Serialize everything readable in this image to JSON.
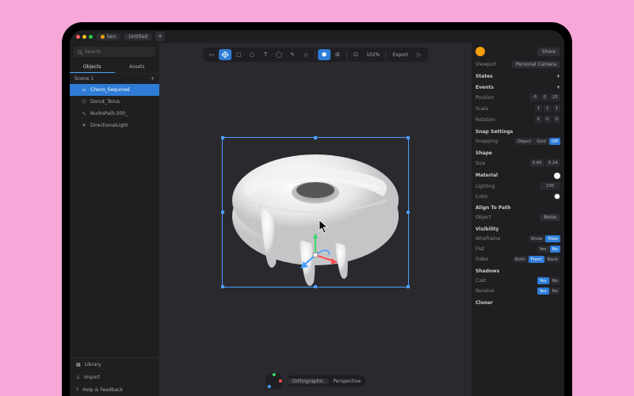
{
  "titlebar": {
    "user": "ben",
    "file": "Untitled"
  },
  "sidebar": {
    "search_placeholder": "Search",
    "tabs": [
      "Objects",
      "Assets"
    ],
    "scene_label": "Scene 1",
    "tree": [
      {
        "label": "Choco_Sequined",
        "icon": "cube",
        "selected": true
      },
      {
        "label": "Donut_Torus",
        "icon": "shape"
      },
      {
        "label": "NurbsPath.000_",
        "icon": "path"
      },
      {
        "label": "DirectionalLight",
        "icon": "light"
      }
    ],
    "footer": [
      "Library",
      "Import",
      "Help & Feedback"
    ]
  },
  "toolbar": {
    "zoom": "102%",
    "export": "Export"
  },
  "view": {
    "modes": [
      "Orthographic",
      "Perspective"
    ],
    "active": 0
  },
  "panel": {
    "share": "Share",
    "viewport": {
      "label": "Viewport",
      "camera": "Personal Camera"
    },
    "states": "States",
    "events": "Events",
    "transform": {
      "position": {
        "label": "Position",
        "x": "-5",
        "y": "0",
        "z": "25"
      },
      "scale": {
        "label": "Scale",
        "x": "1",
        "y": "1",
        "z": "1"
      },
      "rotation": {
        "label": "Rotation",
        "x": "0",
        "y": "0",
        "z": "0"
      }
    },
    "snap": {
      "header": "Snap Settings",
      "label": "Snapping",
      "opts": [
        "Object",
        "Grid",
        "Off"
      ],
      "active": 2
    },
    "shape": {
      "header": "Shape",
      "size_label": "Size",
      "v1": "0.65",
      "v2": "0.24"
    },
    "material": {
      "header": "Material",
      "lighting_label": "Lighting",
      "lighting": "100",
      "color_label": "Color",
      "color": "#ffffff"
    },
    "align": {
      "header": "Align To Path",
      "object_label": "Object",
      "value": "None"
    },
    "visibility": {
      "header": "Visibility",
      "rows": [
        {
          "label": "Wireframe",
          "opts": [
            "Show",
            "Hide"
          ],
          "active": 1
        },
        {
          "label": "Flat",
          "opts": [
            "Yes",
            "No"
          ],
          "active": 1
        },
        {
          "label": "Sides",
          "opts": [
            "Both",
            "Front",
            "Back"
          ],
          "active": 1
        }
      ]
    },
    "shadows": {
      "header": "Shadows",
      "rows": [
        {
          "label": "Cast",
          "opts": [
            "Yes",
            "No"
          ],
          "active": 0
        },
        {
          "label": "Receive",
          "opts": [
            "Yes",
            "No"
          ],
          "active": 0
        }
      ]
    },
    "cloner": "Cloner"
  }
}
